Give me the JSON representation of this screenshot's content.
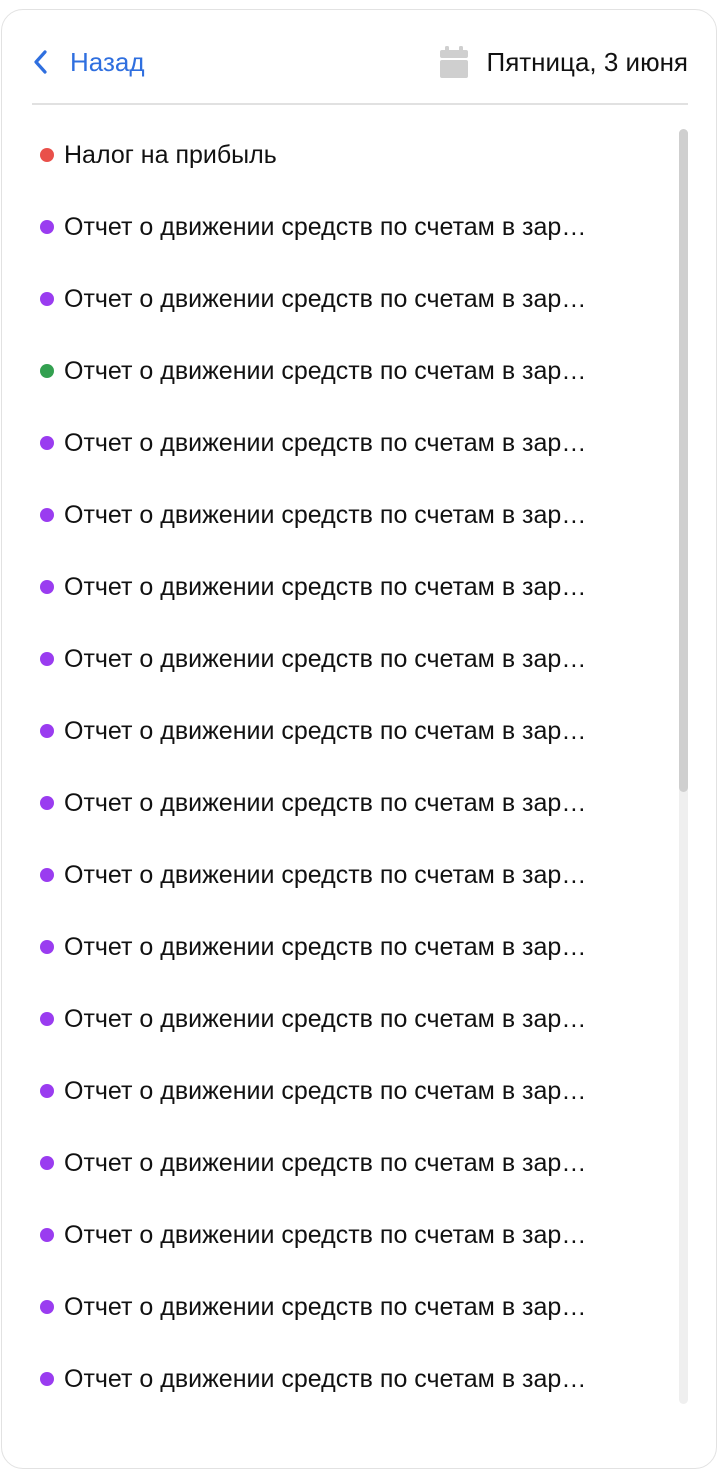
{
  "header": {
    "back_label": "Назад",
    "date_label": "Пятница, 3 июня",
    "back_icon": "chevron-left-icon",
    "date_icon": "calendar-icon"
  },
  "colors": {
    "accent": "#2f6fdf",
    "red": "#e9504a",
    "purple": "#9a3cf0",
    "green": "#33a050",
    "calendar_icon": "#cfcfcf"
  },
  "list": {
    "items": [
      {
        "label": "Налог на прибыль",
        "color": "#e9504a"
      },
      {
        "label": "Отчет о движении средств по счетам в зар…",
        "color": "#9a3cf0"
      },
      {
        "label": "Отчет о движении средств по счетам в зар…",
        "color": "#9a3cf0"
      },
      {
        "label": "Отчет о движении средств по счетам в зар…",
        "color": "#33a050"
      },
      {
        "label": "Отчет о движении средств по счетам в зар…",
        "color": "#9a3cf0"
      },
      {
        "label": "Отчет о движении средств по счетам в зар…",
        "color": "#9a3cf0"
      },
      {
        "label": "Отчет о движении средств по счетам в зар…",
        "color": "#9a3cf0"
      },
      {
        "label": "Отчет о движении средств по счетам в зар…",
        "color": "#9a3cf0"
      },
      {
        "label": "Отчет о движении средств по счетам в зар…",
        "color": "#9a3cf0"
      },
      {
        "label": "Отчет о движении средств по счетам в зар…",
        "color": "#9a3cf0"
      },
      {
        "label": "Отчет о движении средств по счетам в зар…",
        "color": "#9a3cf0"
      },
      {
        "label": "Отчет о движении средств по счетам в зар…",
        "color": "#9a3cf0"
      },
      {
        "label": "Отчет о движении средств по счетам в зар…",
        "color": "#9a3cf0"
      },
      {
        "label": "Отчет о движении средств по счетам в зар…",
        "color": "#9a3cf0"
      },
      {
        "label": "Отчет о движении средств по счетам в зар…",
        "color": "#9a3cf0"
      },
      {
        "label": "Отчет о движении средств по счетам в зар…",
        "color": "#9a3cf0"
      },
      {
        "label": "Отчет о движении средств по счетам в зар…",
        "color": "#9a3cf0"
      },
      {
        "label": "Отчет о движении средств по счетам в зар…",
        "color": "#9a3cf0"
      }
    ]
  },
  "scrollbar": {
    "visible_fraction": 0.52,
    "scroll_position": 0.0
  }
}
